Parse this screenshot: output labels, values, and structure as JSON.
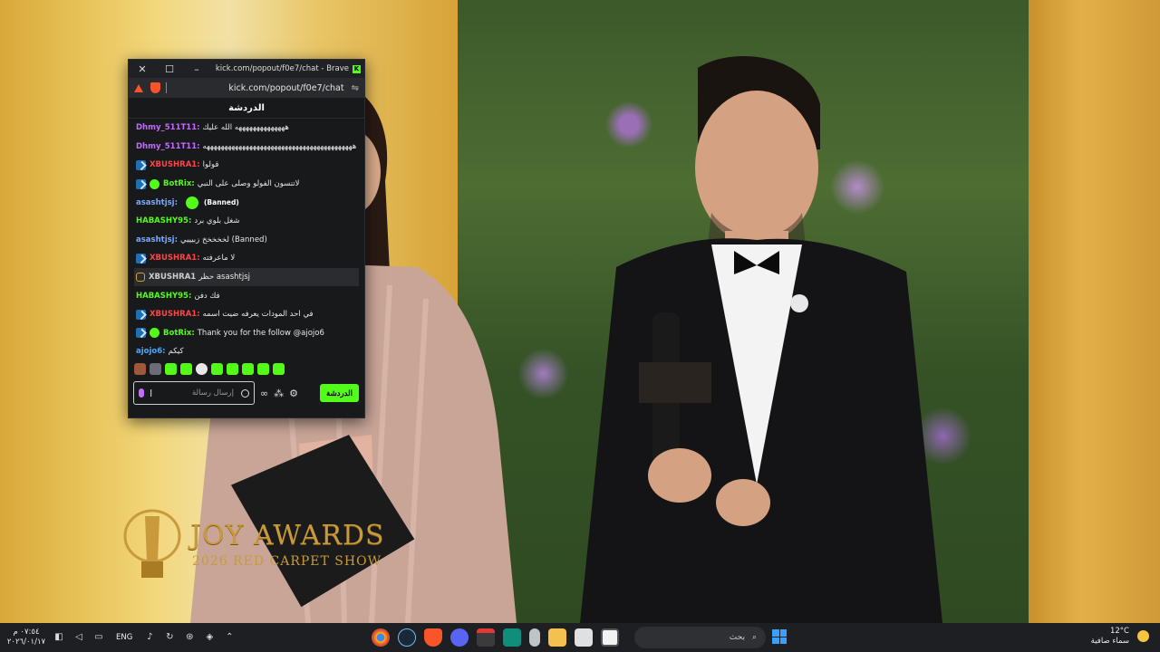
{
  "window": {
    "title": "kick.com/popout/f0e7/chat - Brave",
    "url": "kick.com/popout/f0e7/chat",
    "close": "✕",
    "maximize": "☐",
    "minimize": "–"
  },
  "chat": {
    "header": "الدردشة",
    "messages": [
      {
        "badges": [],
        "user": "Dhmy_511T11:",
        "user_color": "#c46bff",
        "text": "ههههههههههههههه الله عليك"
      },
      {
        "badges": [],
        "user": "Dhmy_511T11:",
        "user_color": "#c46bff",
        "text": "ههههههههههههههههههههههههههههههههههههههههههه"
      },
      {
        "badges": [
          "blue"
        ],
        "user": "XBUSHRA1:",
        "user_color": "#ff4545",
        "text": "قولوا"
      },
      {
        "badges": [
          "blue",
          "green"
        ],
        "user": "BotRix:",
        "user_color": "#53fc18",
        "text": "لاتنسون الفولو وصلى على النبي"
      },
      {
        "badges": [],
        "user": "asashtjsj:",
        "user_color": "#7aa9ff",
        "emote": true,
        "text": "(Banned)"
      },
      {
        "badges": [],
        "user": "HABASHY95:",
        "user_color": "#53fc18",
        "text": "شغل بلوي برد"
      },
      {
        "badges": [],
        "user": "asashtjsj:",
        "user_color": "#7aa9ff",
        "text": "لخخخخخ زبيييي (Banned)"
      },
      {
        "badges": [
          "blue"
        ],
        "user": "XBUSHRA1:",
        "user_color": "#ff4545",
        "text": "لا ماعرفته"
      },
      {
        "badges": [
          "gold"
        ],
        "user": "XBUSHRA1",
        "user_color": "#cfcfcf",
        "text": "حظر asashtjsj",
        "highlight": true
      },
      {
        "badges": [],
        "user": "HABASHY95:",
        "user_color": "#53fc18",
        "text": "فك دفن"
      },
      {
        "badges": [
          "blue"
        ],
        "user": "XBUSHRA1:",
        "user_color": "#ff4545",
        "text": "في احد المودات يعرفه ضيت اسمه"
      },
      {
        "badges": [
          "blue",
          "green"
        ],
        "user": "BotRix:",
        "user_color": "#53fc18",
        "text": "Thank you for the follow @ajojo6"
      },
      {
        "badges": [],
        "user": "ajojo6:",
        "user_color": "#4aa8ff",
        "text": "كيكم"
      }
    ],
    "input_placeholder": "إرسال رسالة",
    "send_label": "الدردشة",
    "emote_bar": [
      "face",
      "person",
      "kick",
      "kick",
      "white",
      "kick",
      "kick",
      "kick",
      "kick",
      "kick"
    ]
  },
  "stream": {
    "award_title": "JOY AWARDS",
    "award_subtitle": "2026 RED CARPET SHOW"
  },
  "taskbar": {
    "time": "٠٧:٥٤ م",
    "date": "٢٠٢٦/٠١/١٧",
    "lang": "ENG",
    "search_placeholder": "بحث",
    "temperature": "12°C",
    "weather_text": "سماء صافية"
  },
  "colors": {
    "kick_green": "#53fc18",
    "chat_bg": "#18191b"
  }
}
